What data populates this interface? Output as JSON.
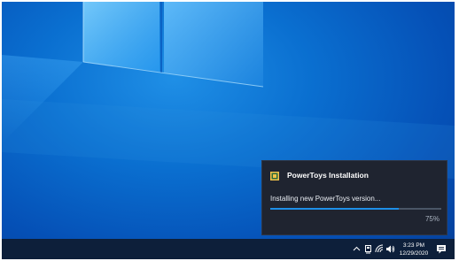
{
  "notification": {
    "title": "PowerToys Installation",
    "message": "Installing new PowerToys version...",
    "progress_text": "75%",
    "progress": 0.75,
    "app_icon": "powertoys-icon"
  },
  "taskbar": {
    "tray_icons": [
      "chevron-up-icon",
      "network-pc-icon",
      "wifi-icon",
      "speaker-icon"
    ],
    "time": "3:23 PM",
    "date": "12/29/2020",
    "action_center_icon": "notification-icon"
  },
  "colors": {
    "accent": "#1e8fe8",
    "toast_background": "#1f2430",
    "taskbar": "#0d1f3a"
  }
}
